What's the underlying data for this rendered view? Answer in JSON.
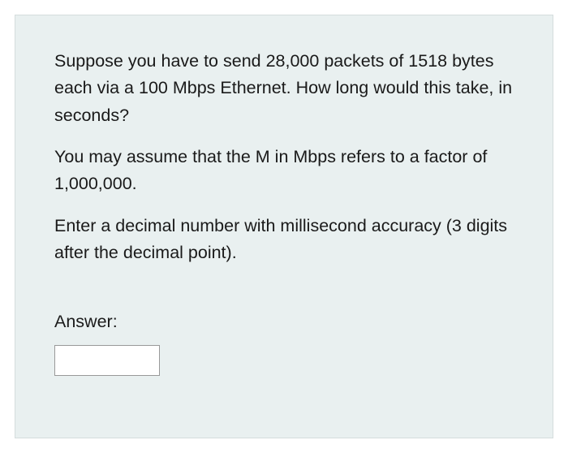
{
  "question": {
    "paragraph1": "Suppose you have to send 28,000 packets of 1518 bytes each via a 100 Mbps Ethernet. How long would this take, in seconds?",
    "paragraph2": "You may assume that the M in Mbps refers to a factor of 1,000,000.",
    "paragraph3": "Enter a decimal number with millisecond accuracy (3 digits after the decimal point)."
  },
  "answer": {
    "label": "Answer:",
    "value": ""
  }
}
